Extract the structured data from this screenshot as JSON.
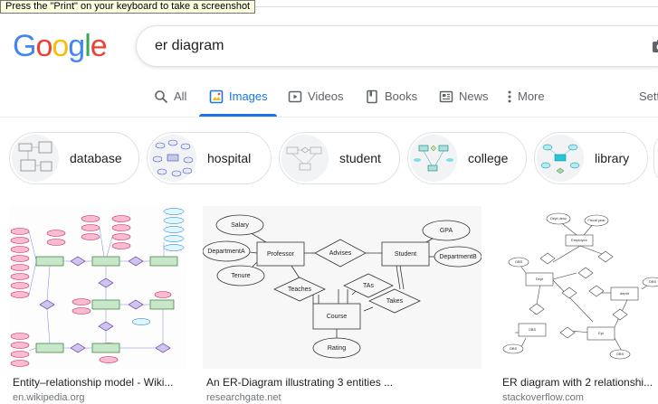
{
  "tooltip": "Press the \"Print\" on your keyboard to take a screenshot",
  "logo": {
    "letters": [
      "G",
      "o",
      "o",
      "g",
      "l",
      "e"
    ],
    "colors": [
      "#4285f4",
      "#ea4335",
      "#fbbc05",
      "#4285f4",
      "#34a853",
      "#ea4335"
    ]
  },
  "search": {
    "query": "er diagram"
  },
  "tabs": [
    {
      "label": "All",
      "icon": "search-icon"
    },
    {
      "label": "Images",
      "icon": "image-icon",
      "active": true
    },
    {
      "label": "Videos",
      "icon": "play-icon"
    },
    {
      "label": "Books",
      "icon": "book-icon"
    },
    {
      "label": "News",
      "icon": "newspaper-icon"
    },
    {
      "label": "More",
      "icon": "vertical-dots-icon"
    },
    {
      "label": "Setti",
      "icon": ""
    }
  ],
  "chips": [
    {
      "label": "database"
    },
    {
      "label": "hospital"
    },
    {
      "label": "student"
    },
    {
      "label": "college"
    },
    {
      "label": "library"
    }
  ],
  "results": [
    {
      "title": "Entity–relationship model - Wiki...",
      "source": "en.wikipedia.org"
    },
    {
      "title": "An ER-Diagram illustrating 3 entities ...",
      "source": "researchgate.net"
    },
    {
      "title": "ER diagram with 2 relationshi...",
      "source": "stackoverflow.com"
    }
  ],
  "diagram2": {
    "entities": [
      "Professor",
      "Student",
      "Course"
    ],
    "relationships": [
      "Advises",
      "Teaches",
      "TAs",
      "Takes"
    ],
    "attributes": [
      "Salary",
      "DepartmentA",
      "Tenure",
      "GPA",
      "DepartmentB",
      "Rating"
    ]
  },
  "diagram3": {
    "entities": [
      "Employee",
      "Dept",
      "dept#",
      "OBS",
      "Epi"
    ],
    "attributes": [
      "Dept desc",
      "Fiscal year",
      "OBS",
      "OBS",
      "OBS",
      "OBS"
    ]
  },
  "colors": {
    "accent": "#1a73e8",
    "text_secondary": "#5f6368",
    "border": "#dfe1e5"
  }
}
